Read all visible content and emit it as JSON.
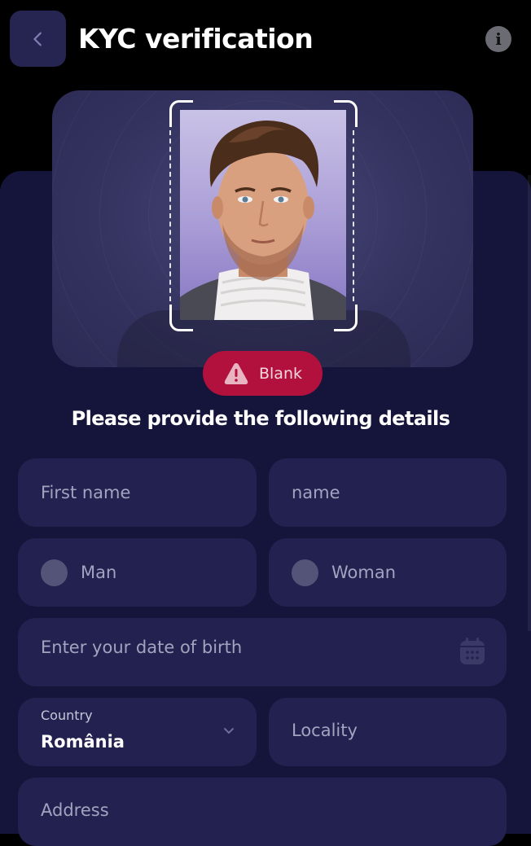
{
  "header": {
    "title": "KYC verification",
    "back_icon": "chevron-left-icon",
    "info_icon": "info-icon",
    "info_glyph": "i"
  },
  "verification": {
    "status_label": "Blank",
    "status_icon": "warning-icon",
    "status_color": "#b3113d",
    "heading": "Please provide the following details"
  },
  "form": {
    "first_name_placeholder": "First name",
    "last_name_placeholder": "name",
    "gender_options": [
      "Man",
      "Woman"
    ],
    "dob_placeholder": "Enter your date of birth",
    "dob_icon": "calendar-icon",
    "country_label": "Country",
    "country_value": "România",
    "locality_placeholder": "Locality",
    "address_placeholder": "Address"
  },
  "colors": {
    "background": "#000000",
    "panel": "#15153b",
    "field": "#222150",
    "accent": "#262552"
  }
}
